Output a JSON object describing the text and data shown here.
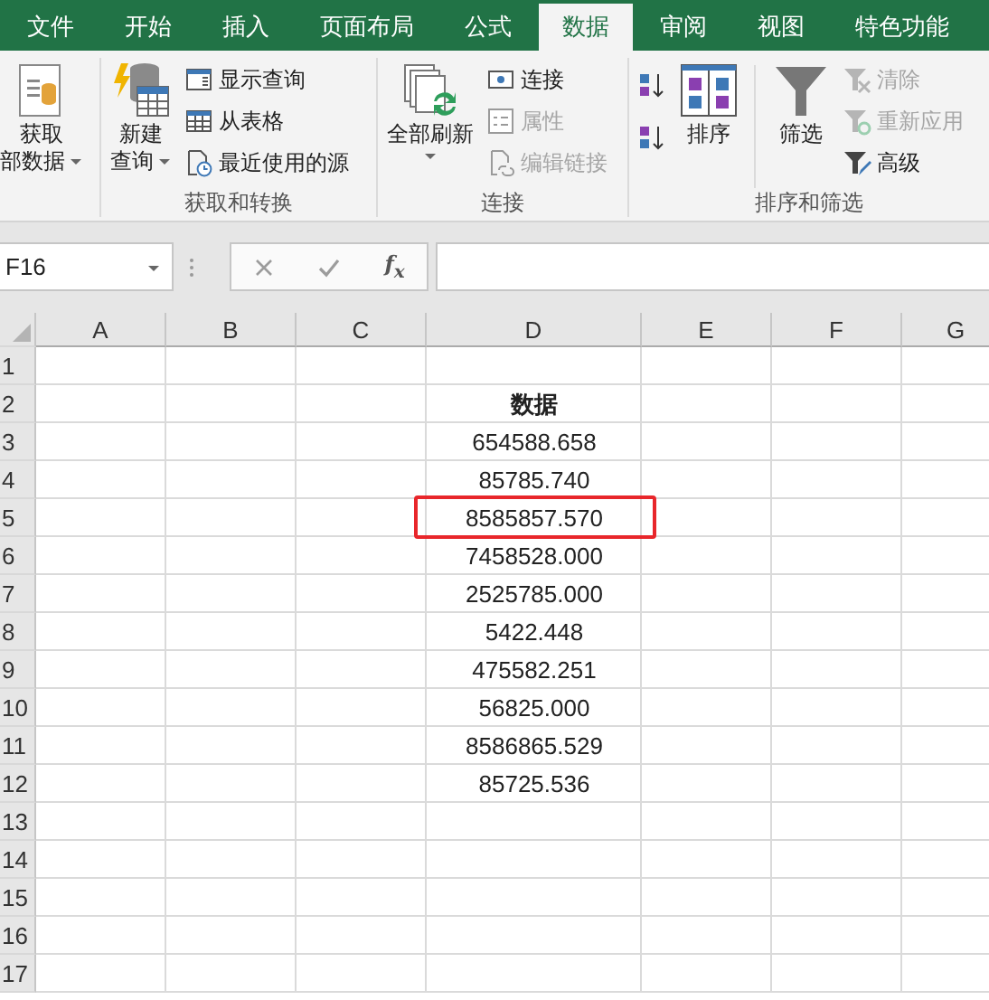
{
  "tabs": [
    {
      "label": "文件",
      "selected": false
    },
    {
      "label": "开始",
      "selected": false
    },
    {
      "label": "插入",
      "selected": false
    },
    {
      "label": "页面布局",
      "selected": false
    },
    {
      "label": "公式",
      "selected": false
    },
    {
      "label": "数据",
      "selected": true
    },
    {
      "label": "审阅",
      "selected": false
    },
    {
      "label": "视图",
      "selected": false
    },
    {
      "label": "特色功能",
      "selected": false
    }
  ],
  "ribbon": {
    "groups": [
      {
        "items": [
          {
            "kind": "large",
            "lines": [
              "获取",
              "部数据"
            ],
            "dropdown": true
          }
        ]
      },
      {
        "label": "获取和转换",
        "items": [
          {
            "kind": "large",
            "lines": [
              "新建",
              "查询"
            ],
            "dropdown": true
          },
          {
            "kind": "stack",
            "items": [
              {
                "label": "显示查询",
                "disabled": false
              },
              {
                "label": "从表格",
                "disabled": false
              },
              {
                "label": "最近使用的源",
                "disabled": false
              }
            ]
          }
        ]
      },
      {
        "label": "连接",
        "items": [
          {
            "kind": "large",
            "lines": [
              "全部刷新"
            ],
            "dropdown": true
          },
          {
            "kind": "stack",
            "items": [
              {
                "label": "连接",
                "disabled": false
              },
              {
                "label": "属性",
                "disabled": true
              },
              {
                "label": "编辑链接",
                "disabled": true
              }
            ]
          }
        ]
      },
      {
        "label": "排序和筛选",
        "items": [
          {
            "kind": "stack",
            "items": [
              {
                "kind": "icon"
              },
              {
                "kind": "icon"
              }
            ]
          },
          {
            "kind": "large",
            "lines": [
              "排序"
            ]
          },
          {
            "kind": "large",
            "lines": [
              "筛选"
            ]
          },
          {
            "kind": "stack",
            "items": [
              {
                "label": "清除",
                "disabled": true
              },
              {
                "label": "重新应用",
                "disabled": true
              },
              {
                "label": "高级",
                "disabled": false
              }
            ]
          }
        ]
      }
    ]
  },
  "formula_bar": {
    "name_box": "F16",
    "function_button": "f$_{x}$"
  },
  "sheet": {
    "columns": [
      "A",
      "B",
      "C",
      "D",
      "E",
      "F",
      "G"
    ],
    "rows": [
      {
        "row": "1"
      },
      {
        "row": "2",
        "D": {
          "text": "数据",
          "kind": "heading",
          "highlighted": false
        }
      },
      {
        "row": "3",
        "D": {
          "text": "654588.658",
          "kind": "value",
          "highlighted": false
        }
      },
      {
        "row": "4",
        "D": {
          "text": "85785.740",
          "kind": "value",
          "highlighted": false
        }
      },
      {
        "row": "5",
        "D": {
          "text": "8585857.570",
          "kind": "value",
          "highlighted": true
        }
      },
      {
        "row": "6",
        "D": {
          "text": "7458528.000",
          "kind": "value",
          "highlighted": false
        }
      },
      {
        "row": "7",
        "D": {
          "text": "2525785.000",
          "kind": "value",
          "highlighted": false
        }
      },
      {
        "row": "8",
        "D": {
          "text": "5422.448",
          "kind": "value",
          "highlighted": false
        }
      },
      {
        "row": "9",
        "D": {
          "text": "475582.251",
          "kind": "value",
          "highlighted": false
        }
      },
      {
        "row": "10",
        "D": {
          "text": "56825.000",
          "kind": "value",
          "highlighted": false
        }
      },
      {
        "row": "11",
        "D": {
          "text": "8586865.529",
          "kind": "value",
          "highlighted": false
        }
      },
      {
        "row": "12",
        "D": {
          "text": "85725.536",
          "kind": "value",
          "highlighted": false
        }
      },
      {
        "row": "13"
      },
      {
        "row": "14"
      },
      {
        "row": "15"
      },
      {
        "row": "16"
      },
      {
        "row": "17"
      }
    ]
  }
}
